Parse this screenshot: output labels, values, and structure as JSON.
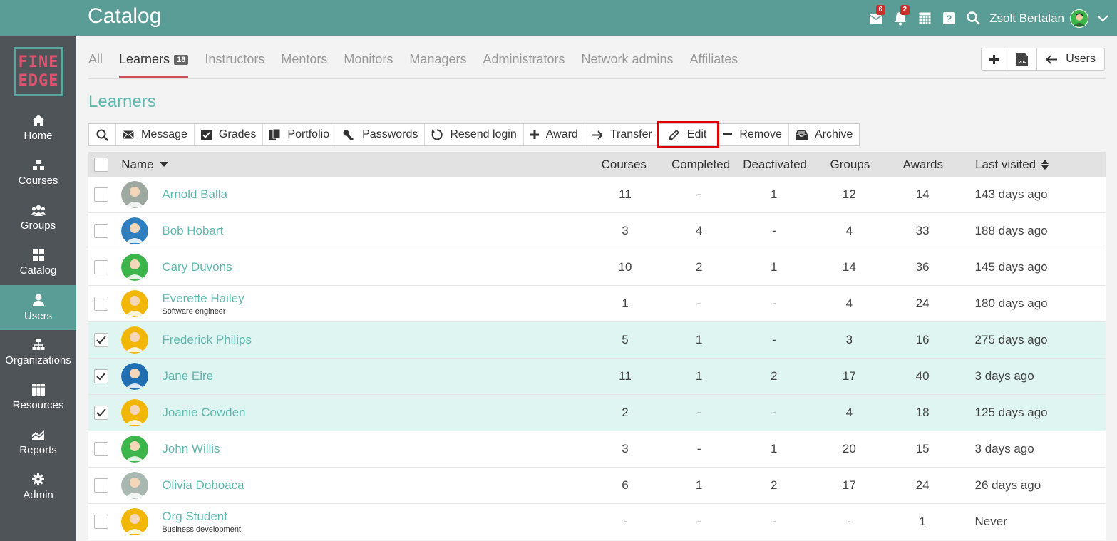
{
  "app_title": "Catalog",
  "header": {
    "messages_badge": "6",
    "notifications_badge": "2",
    "user_name": "Zsolt Bertalan"
  },
  "logo": {
    "line1": "FINE",
    "line2": "EDGE"
  },
  "sidebar": {
    "items": [
      {
        "label": "Home",
        "icon": "home-icon"
      },
      {
        "label": "Courses",
        "icon": "courses-icon"
      },
      {
        "label": "Groups",
        "icon": "groups-icon"
      },
      {
        "label": "Catalog",
        "icon": "catalog-icon"
      },
      {
        "label": "Users",
        "icon": "user-icon"
      },
      {
        "label": "Organizations",
        "icon": "org-icon"
      },
      {
        "label": "Resources",
        "icon": "resources-icon"
      },
      {
        "label": "Reports",
        "icon": "reports-icon"
      },
      {
        "label": "Admin",
        "icon": "gear-icon"
      }
    ]
  },
  "tabs": [
    {
      "label": "All"
    },
    {
      "label": "Learners",
      "count": "18"
    },
    {
      "label": "Instructors"
    },
    {
      "label": "Mentors"
    },
    {
      "label": "Monitors"
    },
    {
      "label": "Managers"
    },
    {
      "label": "Administrators"
    },
    {
      "label": "Network admins"
    },
    {
      "label": "Affiliates"
    }
  ],
  "tab_actions": {
    "add": "+",
    "pdf": "PDF",
    "back_label": "Users"
  },
  "section_title": "Learners",
  "toolbar": {
    "message": "Message",
    "grades": "Grades",
    "portfolio": "Portfolio",
    "passwords": "Passwords",
    "resend": "Resend login",
    "award": "Award",
    "transfer": "Transfer",
    "edit": "Edit",
    "remove": "Remove",
    "archive": "Archive"
  },
  "table": {
    "headers": {
      "name": "Name",
      "courses": "Courses",
      "completed": "Completed",
      "deactivated": "Deactivated",
      "groups": "Groups",
      "awards": "Awards",
      "last": "Last visited"
    },
    "rows": [
      {
        "name": "Arnold Balla",
        "sub": "",
        "courses": "11",
        "completed": "-",
        "deactivated": "1",
        "groups": "12",
        "awards": "14",
        "last": "143 days ago",
        "selected": false,
        "avatar": "#9ca8a0"
      },
      {
        "name": "Bob Hobart",
        "sub": "",
        "courses": "3",
        "completed": "4",
        "deactivated": "-",
        "groups": "4",
        "awards": "33",
        "last": "188 days ago",
        "selected": false,
        "avatar": "#2f7fc0"
      },
      {
        "name": "Cary Duvons",
        "sub": "",
        "courses": "10",
        "completed": "2",
        "deactivated": "1",
        "groups": "14",
        "awards": "36",
        "last": "145 days ago",
        "selected": false,
        "avatar": "#3cb54a"
      },
      {
        "name": "Everette Hailey",
        "sub": "Software engineer",
        "courses": "1",
        "completed": "-",
        "deactivated": "-",
        "groups": "4",
        "awards": "24",
        "last": "180 days ago",
        "selected": false,
        "avatar": "#f2b705"
      },
      {
        "name": "Frederick Philips",
        "sub": "",
        "courses": "5",
        "completed": "1",
        "deactivated": "-",
        "groups": "3",
        "awards": "16",
        "last": "275 days ago",
        "selected": true,
        "avatar": "#f2b705"
      },
      {
        "name": "Jane Eire",
        "sub": "",
        "courses": "11",
        "completed": "1",
        "deactivated": "2",
        "groups": "17",
        "awards": "40",
        "last": "3 days ago",
        "selected": true,
        "avatar": "#1f6fb2"
      },
      {
        "name": "Joanie Cowden",
        "sub": "",
        "courses": "2",
        "completed": "-",
        "deactivated": "-",
        "groups": "4",
        "awards": "18",
        "last": "125 days ago",
        "selected": true,
        "avatar": "#f2b705"
      },
      {
        "name": "John Willis",
        "sub": "",
        "courses": "3",
        "completed": "-",
        "deactivated": "1",
        "groups": "20",
        "awards": "15",
        "last": "3 days ago",
        "selected": false,
        "avatar": "#3cb54a"
      },
      {
        "name": "Olivia Doboaca",
        "sub": "",
        "courses": "6",
        "completed": "1",
        "deactivated": "2",
        "groups": "17",
        "awards": "24",
        "last": "26 days ago",
        "selected": false,
        "avatar": "#a8b8b0"
      },
      {
        "name": "Org Student",
        "sub": "Business development",
        "courses": "-",
        "completed": "-",
        "deactivated": "-",
        "groups": "-",
        "awards": "1",
        "last": "Never",
        "selected": false,
        "avatar": "#f2b705"
      }
    ]
  }
}
